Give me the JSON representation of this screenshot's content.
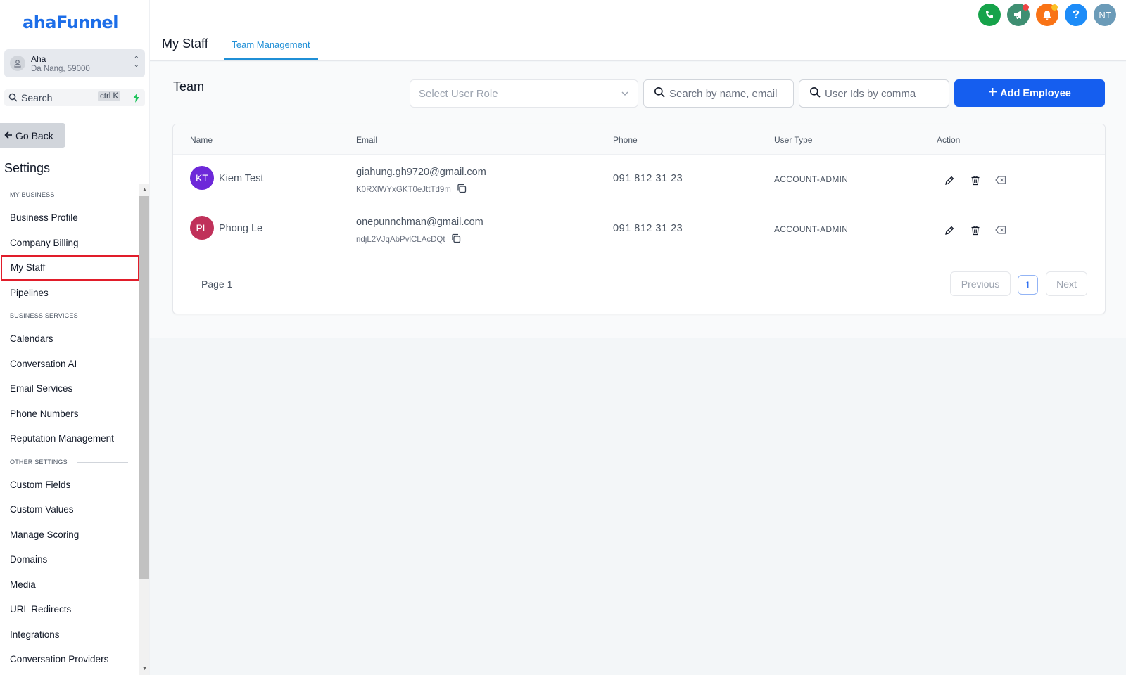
{
  "brand": {
    "logo": "ahaFunnel"
  },
  "location": {
    "name": "Aha",
    "address": "Da Nang, 59000"
  },
  "sidebar_search": {
    "label": "Search",
    "shortcut": "ctrl K"
  },
  "go_back": "Go Back",
  "settings_title": "Settings",
  "nav": {
    "sections": [
      {
        "title": "MY BUSINESS",
        "items": [
          "Business Profile",
          "Company Billing",
          "My Staff",
          "Pipelines"
        ]
      },
      {
        "title": "BUSINESS SERVICES",
        "items": [
          "Calendars",
          "Conversation AI",
          "Email Services",
          "Phone Numbers",
          "Reputation Management"
        ]
      },
      {
        "title": "OTHER SETTINGS",
        "items": [
          "Custom Fields",
          "Custom Values",
          "Manage Scoring",
          "Domains",
          "Media",
          "URL Redirects",
          "Integrations",
          "Conversation Providers"
        ]
      }
    ],
    "active": "My Staff"
  },
  "header": {
    "title": "My Staff",
    "tab": "Team Management",
    "user_initials": "NT",
    "icons": [
      {
        "name": "phone-icon",
        "color": "#16a34a"
      },
      {
        "name": "megaphone-icon",
        "color": "#3f8f72"
      },
      {
        "name": "bell-icon",
        "color": "#f97316"
      },
      {
        "name": "help-icon",
        "color": "#1d8cf8"
      },
      {
        "name": "user-avatar",
        "color": "#6b9bb8"
      }
    ]
  },
  "team": {
    "title": "Team",
    "role_placeholder": "Select User Role",
    "search_name_placeholder": "Search by name, email",
    "search_ids_placeholder": "User Ids by comma",
    "add_label": "Add Employee",
    "columns": {
      "name": "Name",
      "email": "Email",
      "phone": "Phone",
      "user_type": "User Type",
      "action": "Action"
    },
    "rows": [
      {
        "initials": "KT",
        "avatar_color": "#6d28d9",
        "name": "Kiem Test",
        "email": "giahung.gh9720@gmail.com",
        "user_id": "K0RXlWYxGKT0eJttTd9m",
        "phone": "091 812 31 23",
        "user_type": "ACCOUNT-ADMIN"
      },
      {
        "initials": "PL",
        "avatar_color": "#c0315a",
        "name": "Phong Le",
        "email": "onepunnchman@gmail.com",
        "user_id": "ndjL2VJqAbPvlCLAcDQt",
        "phone": "091 812 31 23",
        "user_type": "ACCOUNT-ADMIN"
      }
    ],
    "pagination": {
      "page_label": "Page 1",
      "previous": "Previous",
      "current": "1",
      "next": "Next"
    }
  }
}
